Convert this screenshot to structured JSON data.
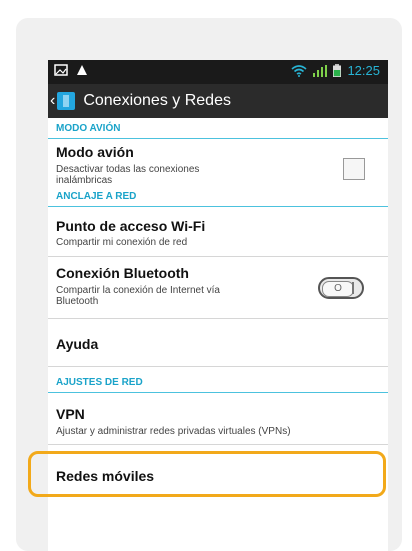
{
  "status_bar": {
    "time": "12:25",
    "icons": [
      "image-icon",
      "warning-icon",
      "wifi-icon",
      "signal-icon",
      "battery-icon"
    ]
  },
  "header": {
    "title": "Conexiones y Redes",
    "back_icon": "back-chevron-icon"
  },
  "sections": {
    "airplane_header": "MODO AVIÓN",
    "tethering_header": "ANCLAJE A RED",
    "network_settings_header": "AJUSTES DE RED"
  },
  "items": {
    "airplane": {
      "title": "Modo avión",
      "subtitle_line1": "Desactivar todas las conexiones",
      "subtitle_line2": "inalámbricas",
      "checked": false
    },
    "hotspot": {
      "title": "Punto de acceso Wi-Fi",
      "subtitle": "Compartir mi conexión de red"
    },
    "bluetooth_tethering": {
      "title": "Conexión Bluetooth",
      "subtitle_line1": "Compartir la conexión de Internet vía",
      "subtitle_line2": "Bluetooth",
      "toggle_state": "off"
    },
    "help": {
      "title": "Ayuda"
    },
    "vpn": {
      "title": "VPN",
      "subtitle": "Ajustar y administrar redes privadas virtuales (VPNs)"
    },
    "mobile_networks": {
      "title": "Redes móviles"
    }
  },
  "colors": {
    "accent": "#1aa3c9",
    "highlight": "#f2a91a",
    "status_bar": "#1a1a1a",
    "title_bar": "#2b2b2b"
  }
}
